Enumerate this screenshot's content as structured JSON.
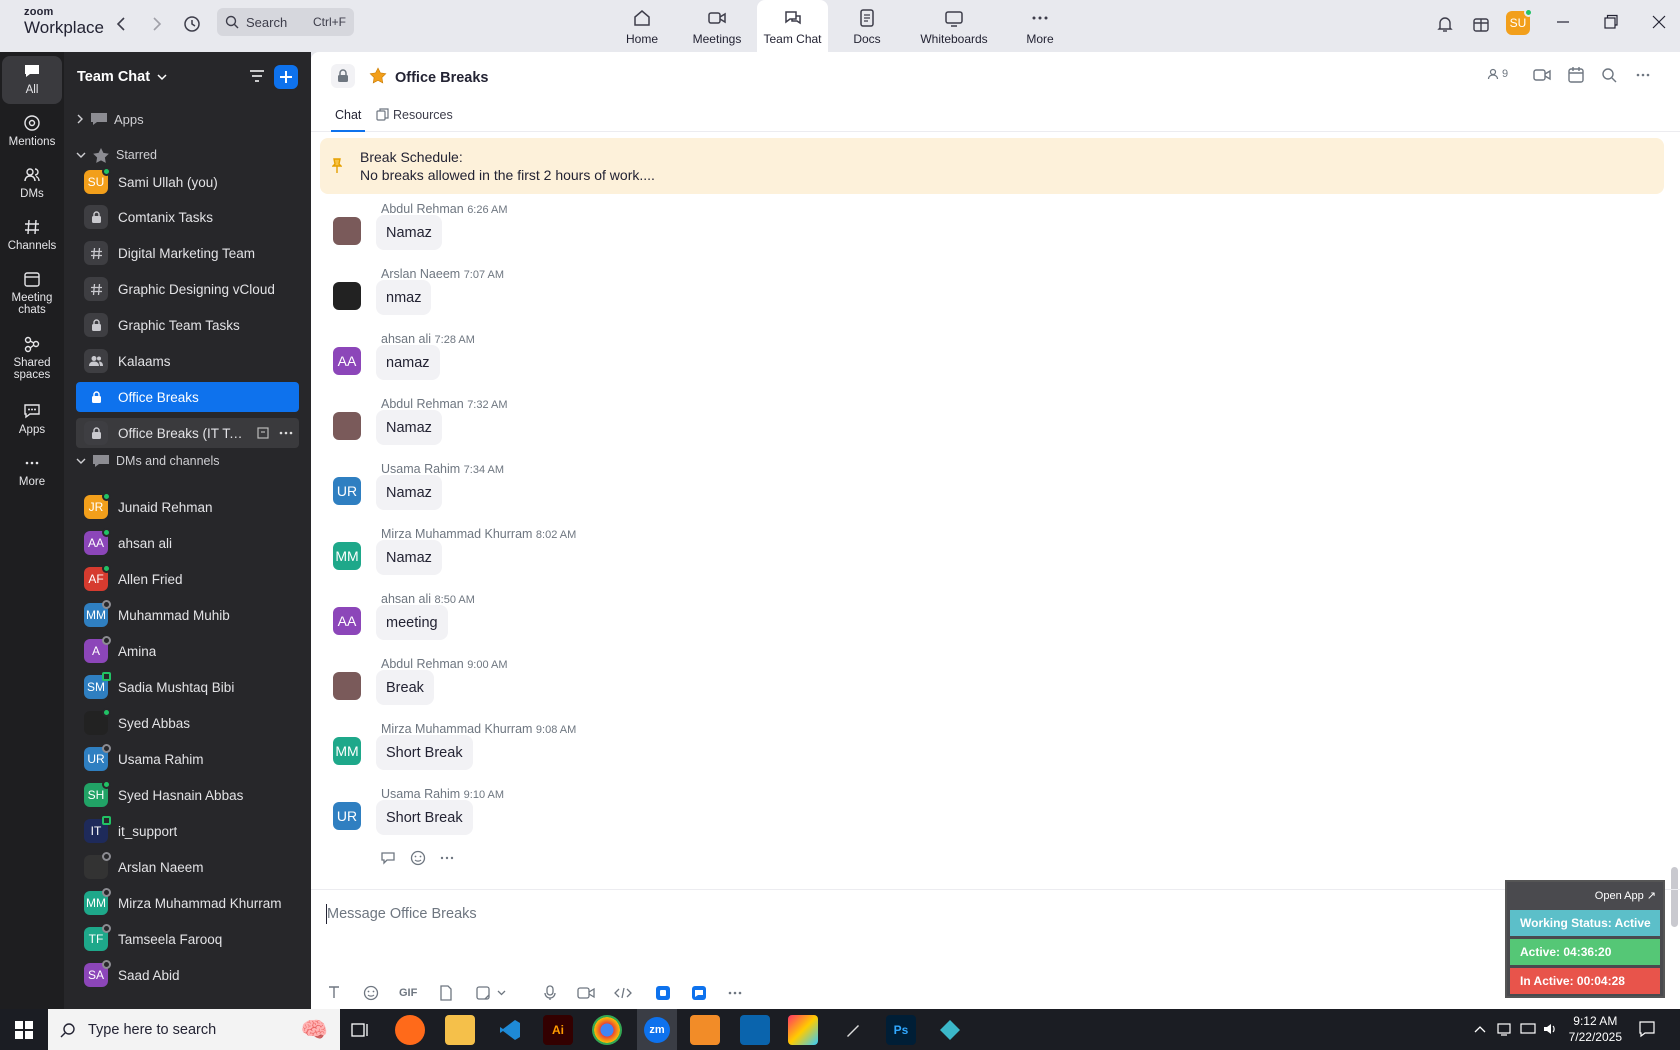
{
  "app": {
    "brand_top": "zoom",
    "brand_bottom": "Workplace"
  },
  "search": {
    "label": "Search",
    "shortcut": "Ctrl+F"
  },
  "nav": {
    "home": "Home",
    "meetings": "Meetings",
    "team_chat": "Team Chat",
    "docs": "Docs",
    "whiteboards": "Whiteboards",
    "more": "More"
  },
  "user": {
    "initials": "SU"
  },
  "rail": {
    "all": "All",
    "mentions": "Mentions",
    "dms": "DMs",
    "channels": "Channels",
    "meeting_chats": "Meeting chats",
    "shared_spaces": "Shared spaces",
    "apps": "Apps",
    "more": "More"
  },
  "sidebar": {
    "title": "Team Chat",
    "apps": "Apps",
    "starred": "Starred",
    "starred_items": [
      {
        "label": "Sami Ullah (you)",
        "initials": "SU",
        "color": "#f29f1b"
      },
      {
        "label": "Comtanix Tasks"
      },
      {
        "label": "Digital Marketing Team"
      },
      {
        "label": "Graphic Designing vCloud"
      },
      {
        "label": "Graphic Team Tasks"
      },
      {
        "label": "Kalaams"
      },
      {
        "label": "Office Breaks"
      },
      {
        "label": "Office Breaks (IT Team)"
      }
    ],
    "dms_title": "DMs and channels",
    "dms": [
      {
        "label": "Junaid Rehman",
        "initials": "JR",
        "color": "#f29f1b"
      },
      {
        "label": "ahsan ali",
        "initials": "AA",
        "color": "#8c46b9"
      },
      {
        "label": "Allen Fried",
        "initials": "AF",
        "color": "#d63b2f"
      },
      {
        "label": "Muhammad Muhib",
        "initials": "MM",
        "color": "#2f7fc1"
      },
      {
        "label": "Amina",
        "initials": "A",
        "color": "#8c46b9"
      },
      {
        "label": "Sadia Mushtaq Bibi",
        "initials": "SM",
        "color": "#2f7fc1"
      },
      {
        "label": "Syed Abbas",
        "initials": "",
        "color": "#222"
      },
      {
        "label": "Usama Rahim",
        "initials": "UR",
        "color": "#2f7fc1"
      },
      {
        "label": "Syed Hasnain Abbas",
        "initials": "SH",
        "color": "#21a366"
      },
      {
        "label": "it_support",
        "initials": "IT",
        "color": "#1e2a5a"
      },
      {
        "label": "Arslan Naeem",
        "initials": "",
        "color": "#333"
      },
      {
        "label": "Mirza Muhammad Khurram",
        "initials": "MM",
        "color": "#1ea88a"
      },
      {
        "label": "Tamseela Farooq",
        "initials": "TF",
        "color": "#1ea88a"
      },
      {
        "label": "Saad Abid",
        "initials": "SA",
        "color": "#8c46b9"
      }
    ]
  },
  "channel": {
    "title": "Office Breaks",
    "members": "9",
    "tabs": {
      "chat": "Chat",
      "resources": "Resources"
    },
    "pinned_title": "Break Schedule:",
    "pinned_text": "No breaks allowed in the first 2 hours of work....",
    "messages": [
      {
        "author": "Abdul Rehman",
        "time": "6:26 AM",
        "text": "Namaz",
        "initials": "",
        "color": "#7a5a5a"
      },
      {
        "author": "Arslan Naeem",
        "time": "7:07 AM",
        "text": "nmaz",
        "initials": "",
        "color": "#222"
      },
      {
        "author": "ahsan ali",
        "time": "7:28 AM",
        "text": "namaz",
        "initials": "AA",
        "color": "#8c46b9"
      },
      {
        "author": "Abdul Rehman",
        "time": "7:32 AM",
        "text": "Namaz",
        "initials": "",
        "color": "#7a5a5a"
      },
      {
        "author": "Usama Rahim",
        "time": "7:34 AM",
        "text": "Namaz",
        "initials": "UR",
        "color": "#2f7fc1"
      },
      {
        "author": "Mirza Muhammad Khurram",
        "time": "8:02 AM",
        "text": "Namaz",
        "initials": "MM",
        "color": "#1ea88a"
      },
      {
        "author": "ahsan ali",
        "time": "8:50 AM",
        "text": "meeting",
        "initials": "AA",
        "color": "#8c46b9"
      },
      {
        "author": "Abdul Rehman",
        "time": "9:00 AM",
        "text": "Break",
        "initials": "",
        "color": "#7a5a5a"
      },
      {
        "author": "Mirza Muhammad Khurram",
        "time": "9:08 AM",
        "text": "Short Break",
        "initials": "MM",
        "color": "#1ea88a"
      },
      {
        "author": "Usama Rahim",
        "time": "9:10 AM",
        "text": "Short Break",
        "initials": "UR",
        "color": "#2f7fc1"
      }
    ],
    "composer_placeholder": "Message Office Breaks",
    "gif": "GIF"
  },
  "widget": {
    "open": "Open App ↗",
    "status": "Working Status: Active",
    "active": "Active: 04:36:20",
    "inactive": "In Active: 00:04:28"
  },
  "taskbar": {
    "search": "Type here to search",
    "time": "9:12 AM",
    "date": "7/22/2025",
    "ai": "Ai",
    "ps": "Ps",
    "zm": "zm"
  }
}
